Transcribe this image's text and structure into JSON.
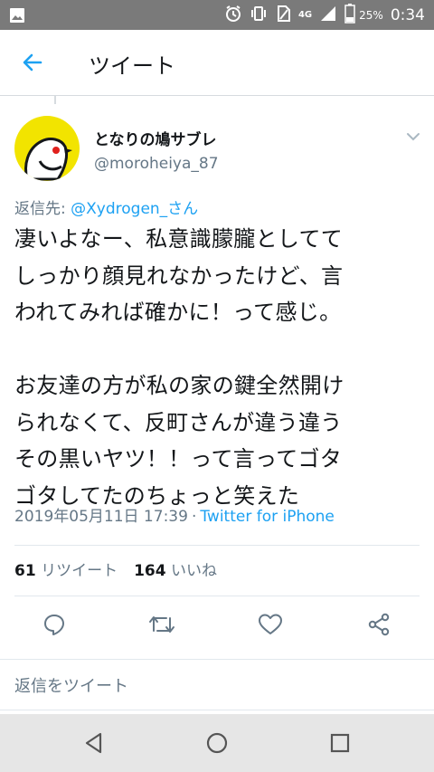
{
  "status_bar": {
    "time": "0:34",
    "battery_percent": "25%",
    "network": "4G"
  },
  "app_bar": {
    "title": "ツイート"
  },
  "tweet": {
    "author": {
      "display_name": "となりの鳩サブレ",
      "handle": "@moroheiya_87"
    },
    "reply_to_label": "返信先: ",
    "reply_to_mention": "@Xydrogen_さん",
    "text": "凄いよなー、私意識朦朧としてて\nしっかり顔見れなかったけど、言\nわれてみれば確かに！って感じ。\n\nお友達の方が私の家の鍵全然開け\nられなくて、反町さんが違う違う\nその黒いヤツ！！って言ってゴタ\nゴタしてたのちょっと笑えた",
    "timestamp": "2019年05月11日 17:39",
    "separator": "·",
    "source": "Twitter for iPhone",
    "retweets_count": "61",
    "retweets_label": "リツイート",
    "likes_count": "164",
    "likes_label": "いいね"
  },
  "reply_box": {
    "placeholder": "返信をツイート"
  },
  "colors": {
    "accent": "#1da1f2",
    "secondary_text": "#657786",
    "status_bar": "#7a7a7a",
    "avatar_bg": "#f2e400"
  }
}
